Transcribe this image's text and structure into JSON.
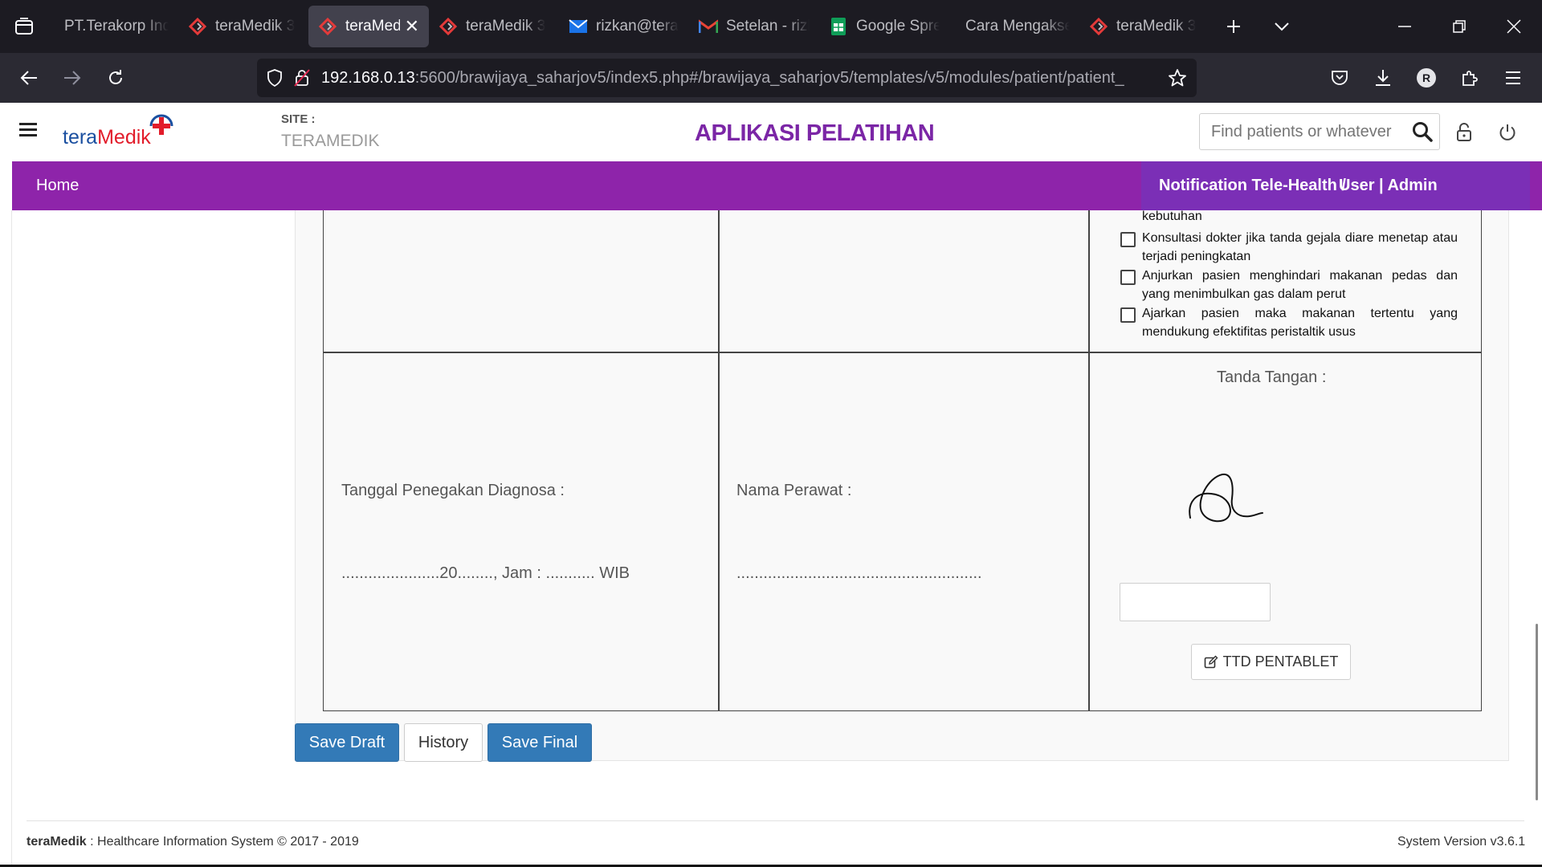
{
  "browser": {
    "tabs": [
      {
        "title": "PT.Terakorp Indo",
        "icon": "none",
        "active": false
      },
      {
        "title": "teraMedik 3",
        "icon": "teramedik-icon",
        "active": false
      },
      {
        "title": "teraMedik",
        "icon": "teramedik-icon",
        "active": true
      },
      {
        "title": "teraMedik 3",
        "icon": "teramedik-icon",
        "active": false
      },
      {
        "title": "rizkan@tera",
        "icon": "mail-icon",
        "active": false
      },
      {
        "title": "Setelan - rizk",
        "icon": "gmail-icon",
        "active": false
      },
      {
        "title": "Google Spre",
        "icon": "sheets-icon",
        "active": false
      },
      {
        "title": "Cara Mengakses",
        "icon": "none",
        "active": false
      },
      {
        "title": "teraMedik 3",
        "icon": "teramedik-icon",
        "active": false
      }
    ],
    "url_host": "192.168.0.13",
    "url_rest": ":5600/brawijaya_saharjov5/index5.php#/brawijaya_saharjov5/templates/v5/modules/patient/patient_",
    "profile_initial": "R"
  },
  "header": {
    "logo_part1": "tera",
    "logo_part2": "Medik",
    "site_label": "SITE :",
    "site_value": "TERAMEDIK",
    "app_title": "APLIKASI PELATIHAN",
    "search_placeholder": "Find patients or whatever"
  },
  "nav": {
    "home": "Home",
    "notification": "Notification Tele-Health  /",
    "user": "User | Admin"
  },
  "form": {
    "partial_text": "kebutuhan",
    "checklist": [
      {
        "text": "Konsultasi dokter jika tanda gejala diare menetap atau terjadi peningkatan",
        "checked": false
      },
      {
        "text": "Anjurkan pasien menghindari makanan pedas dan yang menimbulkan gas dalam perut",
        "checked": false
      },
      {
        "text": "Ajarkan pasien maka makanan tertentu yang mendukung efektifitas peristaltik usus",
        "checked": false
      }
    ],
    "diagnosa_label": "Tanggal Penegakan Diagnosa :",
    "diagnosa_value": "......................20........,    Jam : ........... WIB",
    "perawat_label": "Nama Perawat :",
    "perawat_value": ".......................................................",
    "tanda_tangan_label": "Tanda Tangan :",
    "signature_input_value": "",
    "ttd_button": "TTD PENTABLET"
  },
  "actions": {
    "save_draft": "Save Draft",
    "history": "History",
    "save_final": "Save Final"
  },
  "footer": {
    "brand_part1": "tera",
    "brand_part2": "Medik",
    "copyright": " : Healthcare Information System © 2017 - 2019",
    "version": "System Version v3.6.1"
  }
}
